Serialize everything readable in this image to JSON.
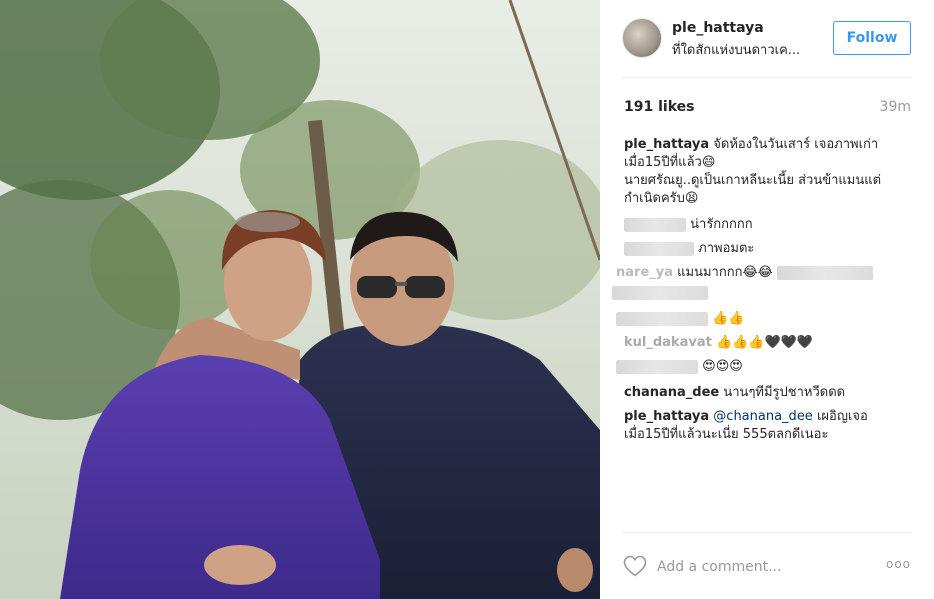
{
  "post": {
    "username": "ple_hattaya",
    "location": "ที่ใดสักแห่งบนดาวเค...",
    "follow_label": "Follow",
    "likes": "191 likes",
    "time": "39m"
  },
  "caption": {
    "line1_user": "ple_hattaya",
    "line1_text": " จัดห้องในวันเสาร์ เจอภาพเก่า",
    "line2": "เมื่อ15ปีที่แล้ว😄",
    "line3": "นายศรัณยู..ดูเป็นเกาหลีนะเนี้ย ส่วนข้าแมนแต่",
    "line4": "กำเนิดครับ😫"
  },
  "comments": {
    "c1_text": "น่ารักกกกก",
    "c2_text": "ภาพอมตะ",
    "c3_user": "nare_ya",
    "c3_text": " แมนมากกก😂😂",
    "c5_text": "👍👍",
    "c6_user": "kul_dakavat",
    "c6_text": " 👍👍👍🖤🖤🖤",
    "c7_text": "😍😍😍",
    "c8_user": "chanana_dee",
    "c8_text": " นานๆทีมีรูปชาหวีดดด",
    "c9_user": "ple_hattaya",
    "c9_mention": "@chanana_dee",
    "c9_text": " เผอิญเจอ",
    "c9_line2": "เมื่อ15ปีที่แล้วนะเนี่ย 555ตลกดีเนอะ"
  },
  "footer": {
    "add_comment_placeholder": "Add a comment...",
    "more_label": "ooo"
  },
  "icons": {
    "like": "heart-icon",
    "more": "more-options-icon"
  },
  "colors": {
    "accent": "#3897f0",
    "muted": "#999999",
    "text": "#262626"
  }
}
